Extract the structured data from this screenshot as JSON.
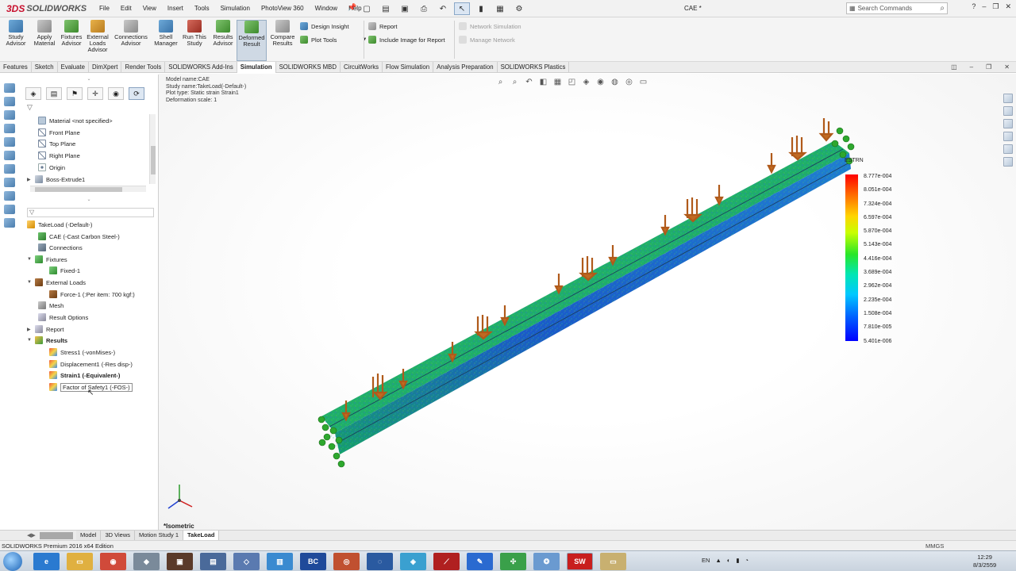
{
  "app": {
    "brand_prefix": "3DS",
    "brand": "SOLIDWORKS",
    "document_title": "CAE *"
  },
  "menu": [
    "File",
    "Edit",
    "View",
    "Insert",
    "Tools",
    "Simulation",
    "PhotoView 360",
    "Window",
    "Help"
  ],
  "search": {
    "placeholder": "Search Commands"
  },
  "ribbon": {
    "buttons": [
      {
        "label": "Study\nAdvisor",
        "icon": "study-advisor-icon"
      },
      {
        "label": "Apply\nMaterial",
        "icon": "apply-material-icon"
      },
      {
        "label": "Fixtures\nAdvisor",
        "icon": "fixtures-advisor-icon"
      },
      {
        "label": "External\nLoads\nAdvisor",
        "icon": "external-loads-icon"
      },
      {
        "label": "Connections\nAdvisor",
        "icon": "connections-advisor-icon"
      },
      {
        "label": "Shell\nManager",
        "icon": "shell-manager-icon"
      },
      {
        "label": "Run This\nStudy",
        "icon": "run-study-icon"
      },
      {
        "label": "Results\nAdvisor",
        "icon": "results-advisor-icon"
      },
      {
        "label": "Deformed\nResult",
        "icon": "deformed-result-icon",
        "selected": true
      },
      {
        "label": "Compare\nResults",
        "icon": "compare-results-icon"
      }
    ],
    "small": {
      "design_insight": "Design Insight",
      "plot_tools": "Plot Tools",
      "report": "Report",
      "include_image": "Include Image for Report",
      "network_simulation": "Network Simulation",
      "manage_network": "Manage Network"
    }
  },
  "tabs": [
    "Features",
    "Sketch",
    "Evaluate",
    "DimXpert",
    "Render Tools",
    "SOLIDWORKS Add-Ins",
    "Simulation",
    "SOLIDWORKS MBD",
    "CircuitWorks",
    "Flow Simulation",
    "Analysis Preparation",
    "SOLIDWORKS Plastics"
  ],
  "active_tab": "Simulation",
  "feature_tree": {
    "material": "Material <not specified>",
    "front_plane": "Front Plane",
    "top_plane": "Top Plane",
    "right_plane": "Right Plane",
    "origin": "Origin",
    "boss_extrude": "Boss-Extrude1"
  },
  "sim_tree": {
    "study": "TakeLoad (-Default-)",
    "material": "CAE (-Cast Carbon Steel-)",
    "connections": "Connections",
    "fixtures": "Fixtures",
    "fixed": "Fixed-1",
    "external_loads": "External Loads",
    "force": "Force-1 (:Per item: 700 kgf:)",
    "mesh": "Mesh",
    "result_options": "Result Options",
    "report": "Report",
    "results": "Results",
    "stress": "Stress1 (-vonMises-)",
    "displacement": "Displacement1 (-Res disp-)",
    "strain": "Strain1 (-Equivalent-)",
    "fos": "Factor of Safety1 (-FOS-)"
  },
  "graphics": {
    "model_name": "Model name:CAE",
    "study_name": "Study name:TakeLoad(-Default-)",
    "plot_type": "Plot type: Static strain Strain1",
    "deformation": "Deformation scale: 1",
    "view_label": "*Isometric",
    "legend_title": "ESTRN",
    "legend_values": [
      "8.777e-004",
      "8.051e-004",
      "7.324e-004",
      "6.597e-004",
      "5.870e-004",
      "5.143e-004",
      "4.416e-004",
      "3.689e-004",
      "2.962e-004",
      "2.235e-004",
      "1.508e-004",
      "7.810e-005",
      "5.401e-006"
    ]
  },
  "bottom_tabs": [
    "Model",
    "3D Views",
    "Motion Study 1",
    "TakeLoad"
  ],
  "active_bottom_tab": "TakeLoad",
  "status": {
    "edition": "SOLIDWORKS Premium 2016 x64 Edition",
    "units": "MMGS"
  },
  "taskbar": {
    "lang": "EN",
    "time": "12:29",
    "date": "8/3/2559"
  }
}
